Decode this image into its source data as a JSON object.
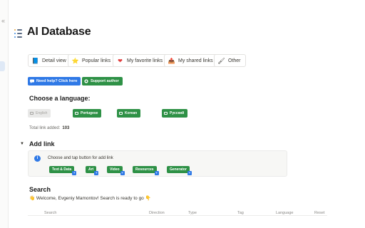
{
  "sidebar": {
    "collapse_glyph": "«"
  },
  "page": {
    "title": "AI Database",
    "icon": "list-icon"
  },
  "nav": [
    {
      "label": "Detail view",
      "icon": "page-icon",
      "glyph": "📘"
    },
    {
      "label": "Popular links",
      "icon": "star-icon",
      "glyph": "⭐"
    },
    {
      "label": "My favorite links",
      "icon": "heart-icon",
      "glyph": "❤"
    },
    {
      "label": "My shared links",
      "icon": "share-icon",
      "glyph": "📤"
    },
    {
      "label": "Other",
      "icon": "brush-icon",
      "glyph": "🖌"
    }
  ],
  "actions": {
    "help_label": "Need help? Click here",
    "support_label": "Support author"
  },
  "language": {
    "heading": "Choose a language:",
    "options": [
      {
        "label": "English",
        "active": false
      },
      {
        "label": "Portugese",
        "active": true
      },
      {
        "label": "Korean",
        "active": true
      },
      {
        "label": "Русский",
        "active": true
      }
    ],
    "total_label": "Total link added:",
    "total_value": "103"
  },
  "add_link": {
    "heading": "Add link",
    "hint": "Choose and tap button for add link",
    "categories": [
      "Text & Data",
      "Art",
      "Video",
      "Resources",
      "Generator"
    ]
  },
  "search": {
    "heading": "Search",
    "welcome": "👋 Welcome, Evgeniy Mamontov! Search is ready to go 👇",
    "columns": [
      "Search",
      "Direction",
      "Type",
      "Tag",
      "Language",
      "Reset"
    ]
  },
  "colors": {
    "blue": "#2f79e6",
    "green": "#2e9146",
    "heart": "#e03e3e"
  }
}
